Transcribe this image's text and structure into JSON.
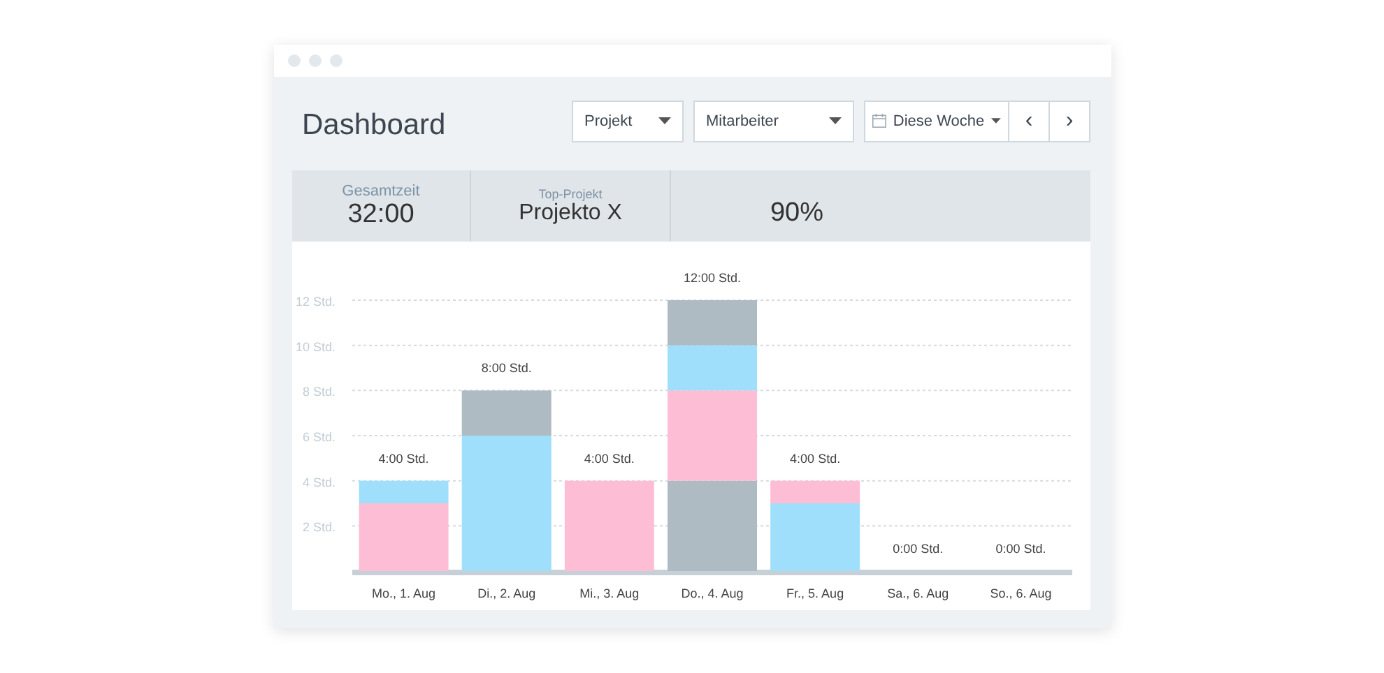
{
  "window": {
    "title": "Dashboard"
  },
  "filters": [
    {
      "kind": "dropdown",
      "label": "Projekt"
    },
    {
      "kind": "dropdown",
      "label": "Mitarbeiter"
    },
    {
      "kind": "date",
      "label": "Diese Woche"
    }
  ],
  "nav": [
    {
      "label": "‹"
    },
    {
      "label": "›"
    }
  ],
  "stats": [
    {
      "label": "Gesamtzeit",
      "value": "32:00"
    },
    {
      "label": "Top-Projekt",
      "value": "Projekto X"
    },
    {
      "value": "90%"
    }
  ],
  "chart": {
    "chart_data": {
      "type": "bar",
      "stacked": true,
      "categories": [
        "Mo., 1. Aug",
        "Di., 2. Aug",
        "Mi., 3. Aug",
        "Do., 4. Aug",
        "Fr., 5. Aug",
        "Sa., 6. Aug",
        "So., 6. Aug"
      ],
      "ylim": [
        0,
        12
      ],
      "grid": true,
      "yticks": [
        {
          "value": 2,
          "label": "2 Std."
        },
        {
          "value": 4,
          "label": "4 Std."
        },
        {
          "value": 6,
          "label": "6 Std."
        },
        {
          "value": 8,
          "label": "8 Std."
        },
        {
          "value": 10,
          "label": "10 Std."
        },
        {
          "value": 12,
          "label": "12 Std."
        }
      ],
      "series": [
        {
          "color": "#aebbc2",
          "values": [
            null,
            null,
            null,
            4,
            null,
            null,
            null
          ]
        },
        {
          "color": "#fdbdd5",
          "values": [
            3,
            null,
            4,
            4,
            null,
            null,
            null
          ]
        },
        {
          "color": "#9fdffb",
          "values": [
            1,
            6,
            null,
            2,
            3,
            null,
            null
          ]
        },
        {
          "color": "#fdbdd5",
          "values": [
            null,
            null,
            null,
            null,
            1,
            null,
            null
          ]
        },
        {
          "color": "#aebbc2",
          "values": [
            null,
            2,
            null,
            2,
            null,
            null,
            null
          ]
        }
      ],
      "value_labels": [
        "4:00 Std.",
        "8:00 Std.",
        "4:00 Std.",
        "12:00 Std.",
        "4:00 Std.",
        "0:00 Std.",
        "0:00 Std."
      ]
    }
  }
}
